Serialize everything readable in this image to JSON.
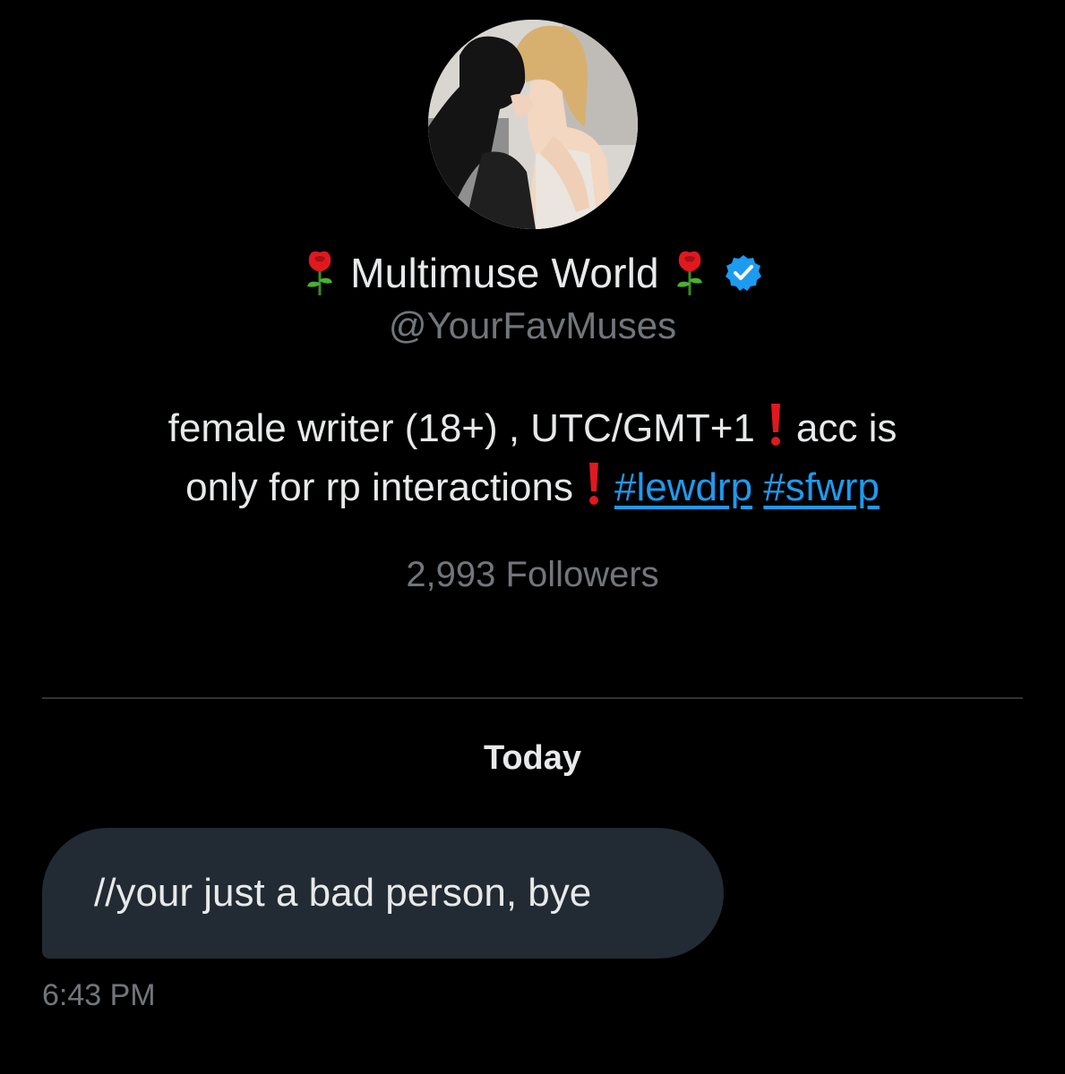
{
  "profile": {
    "display_name": "Multimuse World",
    "name_emoji_left": "rose-emoji",
    "name_emoji_right": "rose-emoji",
    "verified_icon": "verified-badge-icon",
    "handle": "@YourFavMuses",
    "bio": {
      "line1_text_a": "female writer (18+) , UTC/GMT+1",
      "line1_text_b": "acc is",
      "line2_text_a": "only for rp interactions",
      "hashtag1": "#lewdrp",
      "hashtag2": "#sfwrp",
      "excl_icon": "red-exclamation-icon"
    },
    "followers": "2,993 Followers"
  },
  "conversation": {
    "date_label": "Today",
    "messages": [
      {
        "text": "//your just a bad person, bye",
        "time": "6:43 PM"
      }
    ]
  },
  "colors": {
    "background": "#000000",
    "text_primary": "#e7e9ea",
    "text_secondary": "#71767b",
    "link": "#1d9bf0",
    "bubble": "#222b33",
    "verified": "#1d9bf0",
    "divider": "#2f3336"
  }
}
